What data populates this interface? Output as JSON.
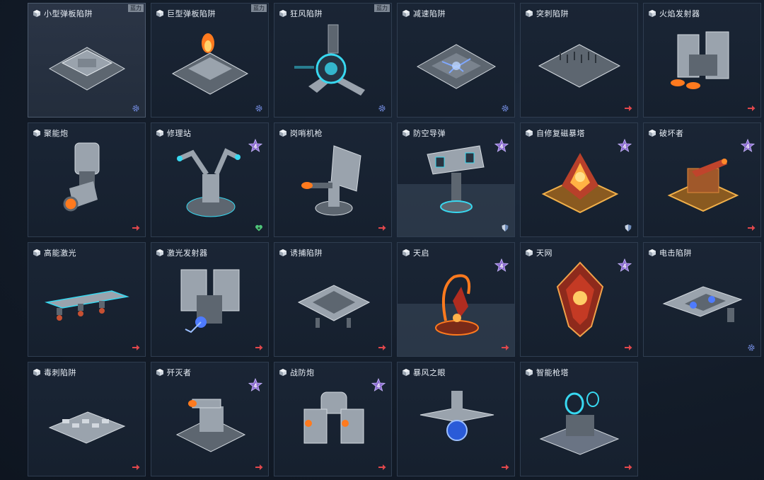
{
  "traps": [
    {
      "name": "小型弹板陷阱",
      "tag": "蓝力",
      "status": "gear-icon",
      "art": "plate",
      "selected": true
    },
    {
      "name": "巨型弹板陷阱",
      "tag": "蓝力",
      "status": "gear-icon",
      "art": "plate-fire"
    },
    {
      "name": "狂风陷阱",
      "tag": "蓝力",
      "status": "gear-icon",
      "art": "fan"
    },
    {
      "name": "减速陷阱",
      "status": "gear-icon",
      "art": "slow"
    },
    {
      "name": "突刺陷阱",
      "status": "arrow-icon",
      "art": "spike"
    },
    {
      "name": "火焰发射器",
      "status": "arrow-icon",
      "art": "flamer"
    },
    {
      "name": "聚能炮",
      "status": "arrow-icon",
      "art": "cannon"
    },
    {
      "name": "修理站",
      "star": "4",
      "status": "heart-icon",
      "art": "repair"
    },
    {
      "name": "岗哨机枪",
      "status": "arrow-icon",
      "art": "sentry"
    },
    {
      "name": "防空导弹",
      "star": "4",
      "status": "shield-icon",
      "art": "missile",
      "highlight": true
    },
    {
      "name": "自修复磁暴塔",
      "star": "4",
      "status": "shield-icon",
      "art": "tesla"
    },
    {
      "name": "破坏者",
      "star": "4",
      "status": "arrow-icon",
      "art": "destroyer"
    },
    {
      "name": "高能激光",
      "status": "arrow-icon",
      "art": "laser"
    },
    {
      "name": "激光发射器",
      "status": "arrow-icon",
      "art": "laser-emitter"
    },
    {
      "name": "诱捕陷阱",
      "status": "arrow-icon",
      "art": "lure"
    },
    {
      "name": "天启",
      "star": "4",
      "status": "arrow-icon",
      "art": "apocalypse",
      "highlight": true
    },
    {
      "name": "天网",
      "star": "4",
      "status": "arrow-icon",
      "art": "skynet"
    },
    {
      "name": "电击陷阱",
      "status": "gear-icon",
      "art": "shock"
    },
    {
      "name": "毒刺陷阱",
      "status": "arrow-icon",
      "art": "poison"
    },
    {
      "name": "歼灭者",
      "star": "4",
      "status": "arrow-icon",
      "art": "annihilator"
    },
    {
      "name": "战防炮",
      "star": "4",
      "status": "arrow-icon",
      "art": "flak"
    },
    {
      "name": "暴风之眼",
      "status": "arrow-icon",
      "art": "storm-eye"
    },
    {
      "name": "智能枪塔",
      "status": "arrow-icon",
      "art": "smart-turret"
    }
  ],
  "colors": {
    "accent_red": "#e0474c",
    "gear_blue": "#6f87d8",
    "heart_green": "#4fc57a",
    "star_purple": "#8c6cd0",
    "cyan_glow": "#38d8f0",
    "fire": "#ff7a1e"
  }
}
